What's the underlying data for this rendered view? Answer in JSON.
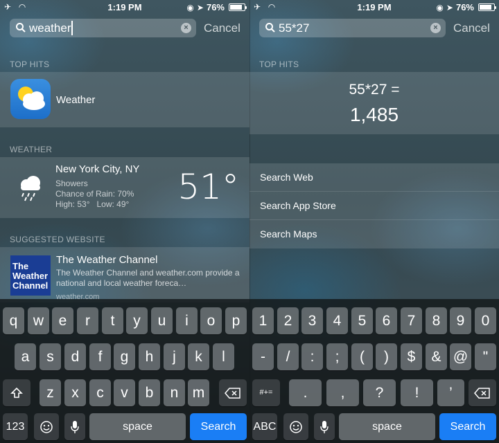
{
  "status_bar": {
    "time": "1:19 PM",
    "battery": "76%",
    "battery_level": 0.76
  },
  "left": {
    "search": {
      "query": "weather",
      "cancel_label": "Cancel"
    },
    "top_hits_header": "TOP HITS",
    "app": {
      "name": "Weather"
    },
    "weather_header": "WEATHER",
    "weather": {
      "city": "New York City, NY",
      "condition": "Showers",
      "rain": "Chance of Rain: 70%",
      "high_low": "High: 53°   Low: 49°",
      "temp": "51°"
    },
    "suggested_header": "SUGGESTED WEBSITE",
    "website": {
      "logo_text": [
        "The",
        "Weather",
        "Channel"
      ],
      "title": "The Weather Channel",
      "desc": "The Weather Channel and weather.com provide a national and local weather foreca…",
      "url": "weather.com"
    },
    "keyboard": {
      "row1": [
        "q",
        "w",
        "e",
        "r",
        "t",
        "y",
        "u",
        "i",
        "o",
        "p"
      ],
      "row2": [
        "a",
        "s",
        "d",
        "f",
        "g",
        "h",
        "j",
        "k",
        "l"
      ],
      "row3": [
        "z",
        "x",
        "c",
        "v",
        "b",
        "n",
        "m"
      ],
      "mode_key": "123",
      "space": "space",
      "search": "Search"
    }
  },
  "right": {
    "search": {
      "query": "55*27",
      "cancel_label": "Cancel"
    },
    "top_hits_header": "TOP HITS",
    "calc": {
      "expression": "55*27 =",
      "result": "1,485"
    },
    "links": [
      "Search Web",
      "Search App Store",
      "Search Maps"
    ],
    "keyboard": {
      "row1": [
        "1",
        "2",
        "3",
        "4",
        "5",
        "6",
        "7",
        "8",
        "9",
        "0"
      ],
      "row2": [
        "-",
        "/",
        ":",
        ";",
        "(",
        ")",
        "$",
        "&",
        "@",
        "\""
      ],
      "row3": [
        ".",
        ",",
        "?",
        "!",
        "’"
      ],
      "symbols_key": "#+=",
      "mode_key": "ABC",
      "space": "space",
      "search": "Search"
    }
  }
}
